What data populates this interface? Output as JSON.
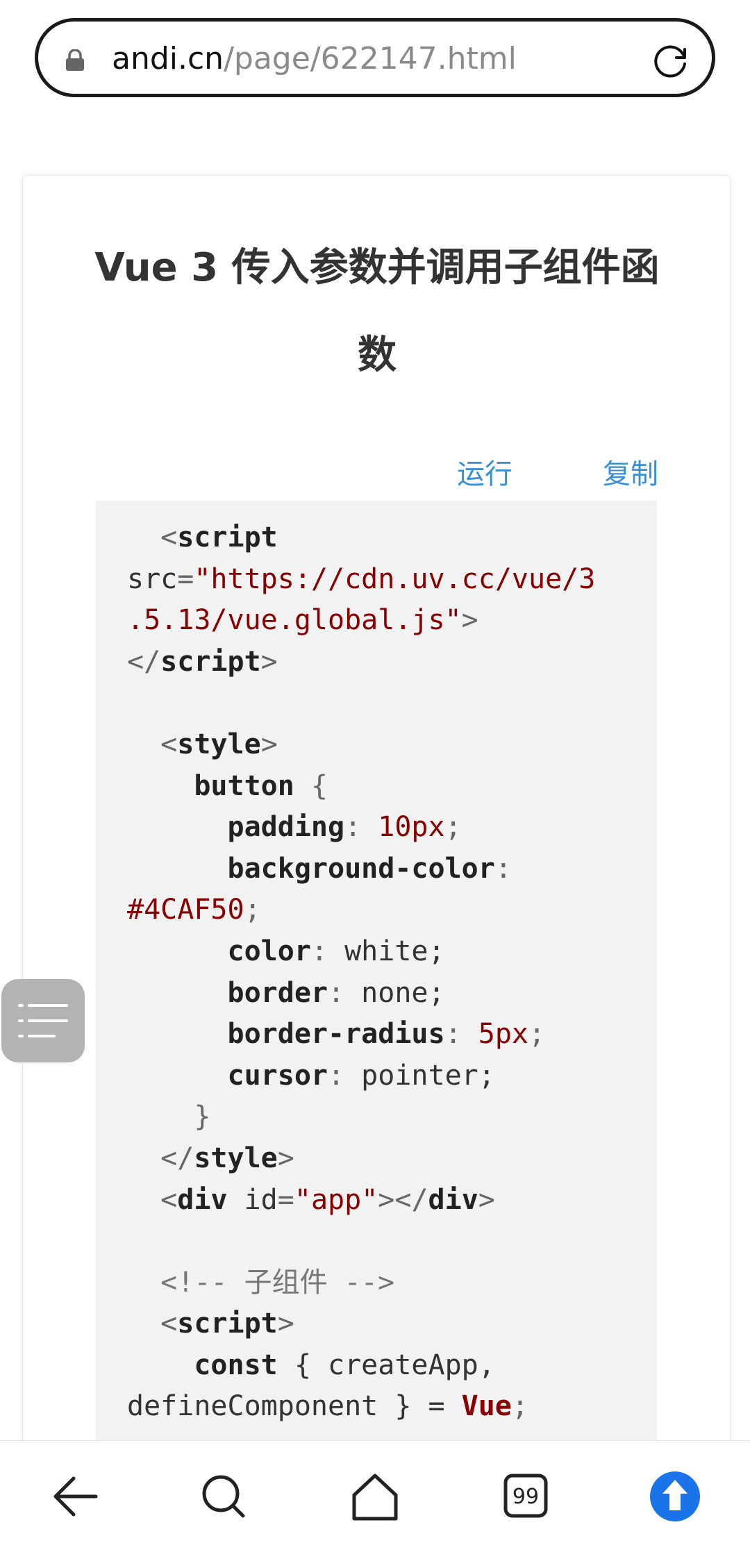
{
  "browser": {
    "url_domain": "andi.cn",
    "url_path": "/page/622147.html"
  },
  "article": {
    "title": "Vue 3 传入参数并调用子组件函数"
  },
  "code_toolbar": {
    "run_label": "运行",
    "copy_label": "复制"
  },
  "code_lines": [
    [
      {
        "t": "  "
      },
      {
        "t": "<",
        "c": "punc"
      },
      {
        "t": "script",
        "c": "tag"
      }
    ],
    [
      {
        "t": "src",
        "c": "attr"
      },
      {
        "t": "=",
        "c": "punc"
      },
      {
        "t": "\"https://cdn.uv.cc/vue/3",
        "c": "str"
      }
    ],
    [
      {
        "t": ".5.13/vue.global.js\"",
        "c": "str"
      },
      {
        "t": ">",
        "c": "punc"
      }
    ],
    [
      {
        "t": "</",
        "c": "punc"
      },
      {
        "t": "script",
        "c": "tag"
      },
      {
        "t": ">",
        "c": "punc"
      }
    ],
    [
      {
        "t": ""
      }
    ],
    [
      {
        "t": "  "
      },
      {
        "t": "<",
        "c": "punc"
      },
      {
        "t": "style",
        "c": "tag"
      },
      {
        "t": ">",
        "c": "punc"
      }
    ],
    [
      {
        "t": "    "
      },
      {
        "t": "button",
        "c": "tag"
      },
      {
        "t": " {",
        "c": "punc"
      }
    ],
    [
      {
        "t": "      "
      },
      {
        "t": "padding",
        "c": "prop"
      },
      {
        "t": ": ",
        "c": "punc"
      },
      {
        "t": "10px",
        "c": "num"
      },
      {
        "t": ";",
        "c": "punc"
      }
    ],
    [
      {
        "t": "      "
      },
      {
        "t": "background-color",
        "c": "prop"
      },
      {
        "t": ":",
        "c": "punc"
      }
    ],
    [
      {
        "t": "#4CAF50",
        "c": "num"
      },
      {
        "t": ";",
        "c": "punc"
      }
    ],
    [
      {
        "t": "      "
      },
      {
        "t": "color",
        "c": "prop"
      },
      {
        "t": ": ",
        "c": "punc"
      },
      {
        "t": "white;",
        "c": "attr"
      }
    ],
    [
      {
        "t": "      "
      },
      {
        "t": "border",
        "c": "prop"
      },
      {
        "t": ": ",
        "c": "punc"
      },
      {
        "t": "none;",
        "c": "attr"
      }
    ],
    [
      {
        "t": "      "
      },
      {
        "t": "border-radius",
        "c": "prop"
      },
      {
        "t": ": ",
        "c": "punc"
      },
      {
        "t": "5px",
        "c": "num"
      },
      {
        "t": ";",
        "c": "punc"
      }
    ],
    [
      {
        "t": "      "
      },
      {
        "t": "cursor",
        "c": "prop"
      },
      {
        "t": ": ",
        "c": "punc"
      },
      {
        "t": "pointer;",
        "c": "attr"
      }
    ],
    [
      {
        "t": "    }",
        "c": "punc"
      }
    ],
    [
      {
        "t": "  "
      },
      {
        "t": "</",
        "c": "punc"
      },
      {
        "t": "style",
        "c": "tag"
      },
      {
        "t": ">",
        "c": "punc"
      }
    ],
    [
      {
        "t": "  "
      },
      {
        "t": "<",
        "c": "punc"
      },
      {
        "t": "div",
        "c": "tag"
      },
      {
        "t": " id",
        "c": "attr"
      },
      {
        "t": "=",
        "c": "punc"
      },
      {
        "t": "\"app\"",
        "c": "str"
      },
      {
        "t": "></",
        "c": "punc"
      },
      {
        "t": "div",
        "c": "tag"
      },
      {
        "t": ">",
        "c": "punc"
      }
    ],
    [
      {
        "t": ""
      }
    ],
    [
      {
        "t": "  "
      },
      {
        "t": "<!-- 子组件 -->",
        "c": "comment"
      }
    ],
    [
      {
        "t": "  "
      },
      {
        "t": "<",
        "c": "punc"
      },
      {
        "t": "script",
        "c": "tag"
      },
      {
        "t": ">",
        "c": "punc"
      }
    ],
    [
      {
        "t": "    "
      },
      {
        "t": "const",
        "c": "kw"
      },
      {
        "t": " { createApp,",
        "c": "attr"
      }
    ],
    [
      {
        "t": "defineComponent } = ",
        "c": "attr"
      },
      {
        "t": "Vue",
        "c": "cls"
      },
      {
        "t": ";",
        "c": "punc"
      }
    ]
  ],
  "icons": {
    "lock": "lock-icon",
    "reload": "reload-icon",
    "toc": "menu-list-icon",
    "back": "arrow-left-icon",
    "search": "search-icon",
    "home": "home-icon",
    "tabs": "tabs-count-icon",
    "top": "arrow-up-circle-icon"
  },
  "tabs_count": "99",
  "colors": {
    "accent": "#1a73e8",
    "link": "#3a8fd6",
    "code_string": "#880000",
    "code_bg": "#f2f2f2"
  }
}
